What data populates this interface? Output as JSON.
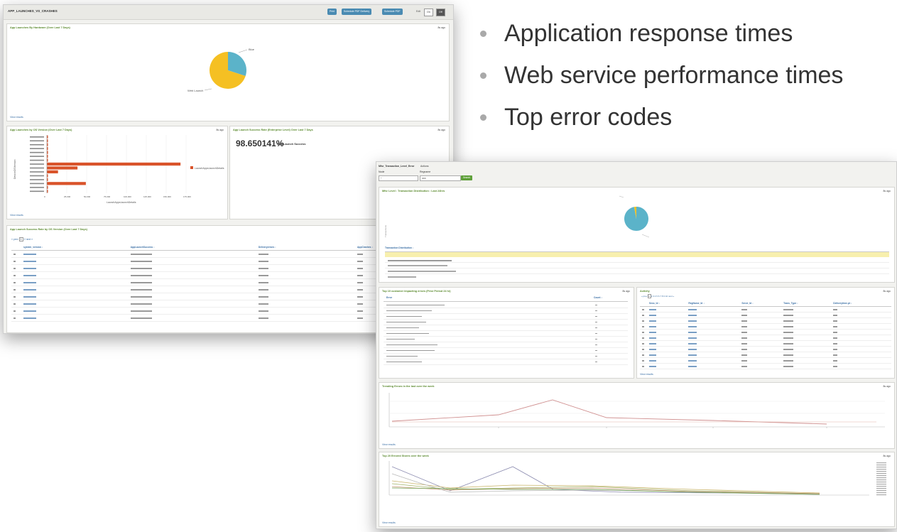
{
  "bullets": [
    {
      "text": "Application response times"
    },
    {
      "text": "Web service performance times"
    },
    {
      "text": "Top error codes"
    }
  ],
  "shot_a": {
    "title": "APP_LAUNCHES_VS_CRASHES",
    "buttons": [
      "Print",
      "Schedule PDF Delivery",
      "Schedule PDF"
    ],
    "edit_label": "Edit",
    "segments": [
      "On",
      "Off"
    ],
    "pie_panel": {
      "title": "App Launches By Hardware (Over Last 7 Days)",
      "ago": "8s ago",
      "slices": [
        {
          "label": "Blue",
          "value": 30,
          "color": "#5bb3c9"
        },
        {
          "label": "Web Launch",
          "value": 70,
          "color": "#f5c023"
        }
      ],
      "view_results": "View results"
    },
    "bar_panel": {
      "title": "App Launches by OS Version (Over Last 7 Days)",
      "ago": "8s ago",
      "legend": "LaunchApps.launchDetails",
      "ylabel": "DeviceOSVersion",
      "xlabel": "LaunchApps.launchDetails",
      "x_ticks": [
        "0",
        "25,000",
        "50,000",
        "75,000",
        "100,000",
        "125,000",
        "150,000",
        "175,000"
      ],
      "view_results": "View results"
    },
    "rate_panel": {
      "title": "App Launch Success Rate (Enterprise Level) Over Last 7 Days",
      "ago": "8s ago",
      "value": "98.650141%",
      "label": "App Launch Success"
    },
    "table_panel": {
      "title": "App Launch Success Rate by OS Version (Over Last 7 Days)",
      "pager": [
        "« prev",
        "1",
        "2",
        "next »"
      ],
      "columns": [
        "system_version ↕",
        "AppLaunchSuccess ↕",
        "Deliveryerrors ↕",
        "AppCrashes ↕"
      ]
    }
  },
  "shot_b": {
    "filter_title": "Mfsr_Transaction_Level_Error",
    "actions": "Actions",
    "filter_labels": [
      "Node",
      "Regname"
    ],
    "filter_values": [
      "*",
      "OFF"
    ],
    "search_label": "Search",
    "pie_panel": {
      "title": "Mfsr Level : Transaction Distribution : Last 24hrs",
      "ago": "8s ago",
      "slices": [
        {
          "label": "Transactions without errors",
          "value": 97,
          "color": "#5bb3c9"
        },
        {
          "label": "Errors",
          "value": 3,
          "color": "#f5c023"
        }
      ],
      "table_header": "Transaction Distribution ↕"
    },
    "errors_panel": {
      "title": "Top 10 customer impacting errors (Prior Period 24 hr)",
      "ago": "8s ago",
      "columns": [
        "Error",
        "Count ↕"
      ]
    },
    "activity_panel": {
      "title": "Activity",
      "ago": "8s ago",
      "pager": [
        "« prev",
        "1",
        "2",
        "3",
        "4",
        "5",
        "6",
        "7",
        "8",
        "9",
        "10",
        "next »"
      ],
      "columns": [
        "Sess_Id ↕",
        "RegName_Id ↕",
        "Serve_Id ↕",
        "Trans_Type ↕",
        "Deliverytime.pt ↕"
      ],
      "view_results": "View results"
    },
    "line_panel": {
      "title": "Trending Errors in the last over the week",
      "ago": "8s ago",
      "view_results": "View results"
    },
    "multi_panel": {
      "title": "Top 20 Errored Stores over the week",
      "ago": "8s ago",
      "view_results": "View results"
    }
  },
  "colors": {
    "bar": "#d9532a",
    "accent_title": "#5b8a2e",
    "link": "#3a6fa5",
    "highlight": "#f7efae"
  }
}
